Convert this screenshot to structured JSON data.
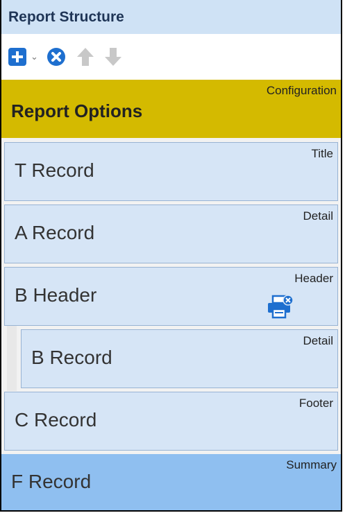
{
  "panel": {
    "title": "Report Structure"
  },
  "toolbar": {
    "add": {
      "icon": "plus-square-icon"
    },
    "dropdown": {
      "icon": "chevron-down-icon",
      "glyph": "⌄"
    },
    "remove": {
      "icon": "remove-circle-icon"
    },
    "move_up": {
      "icon": "arrow-up-icon"
    },
    "move_down": {
      "icon": "arrow-down-icon"
    }
  },
  "items": [
    {
      "name": "Report Options",
      "type": "Configuration"
    },
    {
      "name": "T Record",
      "type": "Title"
    },
    {
      "name": "A Record",
      "type": "Detail"
    },
    {
      "name": "B Header",
      "type": "Header",
      "icon": "printer-cancel-icon"
    },
    {
      "name": "B Record",
      "type": "Detail"
    },
    {
      "name": "C Record",
      "type": "Footer"
    },
    {
      "name": "F Record",
      "type": "Summary"
    }
  ],
  "colors": {
    "title_bar": "#cfe2f5",
    "config_card": "#d4ba00",
    "record_card": "#d6e5f6",
    "selected_card": "#8fbff0",
    "icon_blue": "#1e6fcf",
    "icon_disabled": "#c8c8c8"
  }
}
